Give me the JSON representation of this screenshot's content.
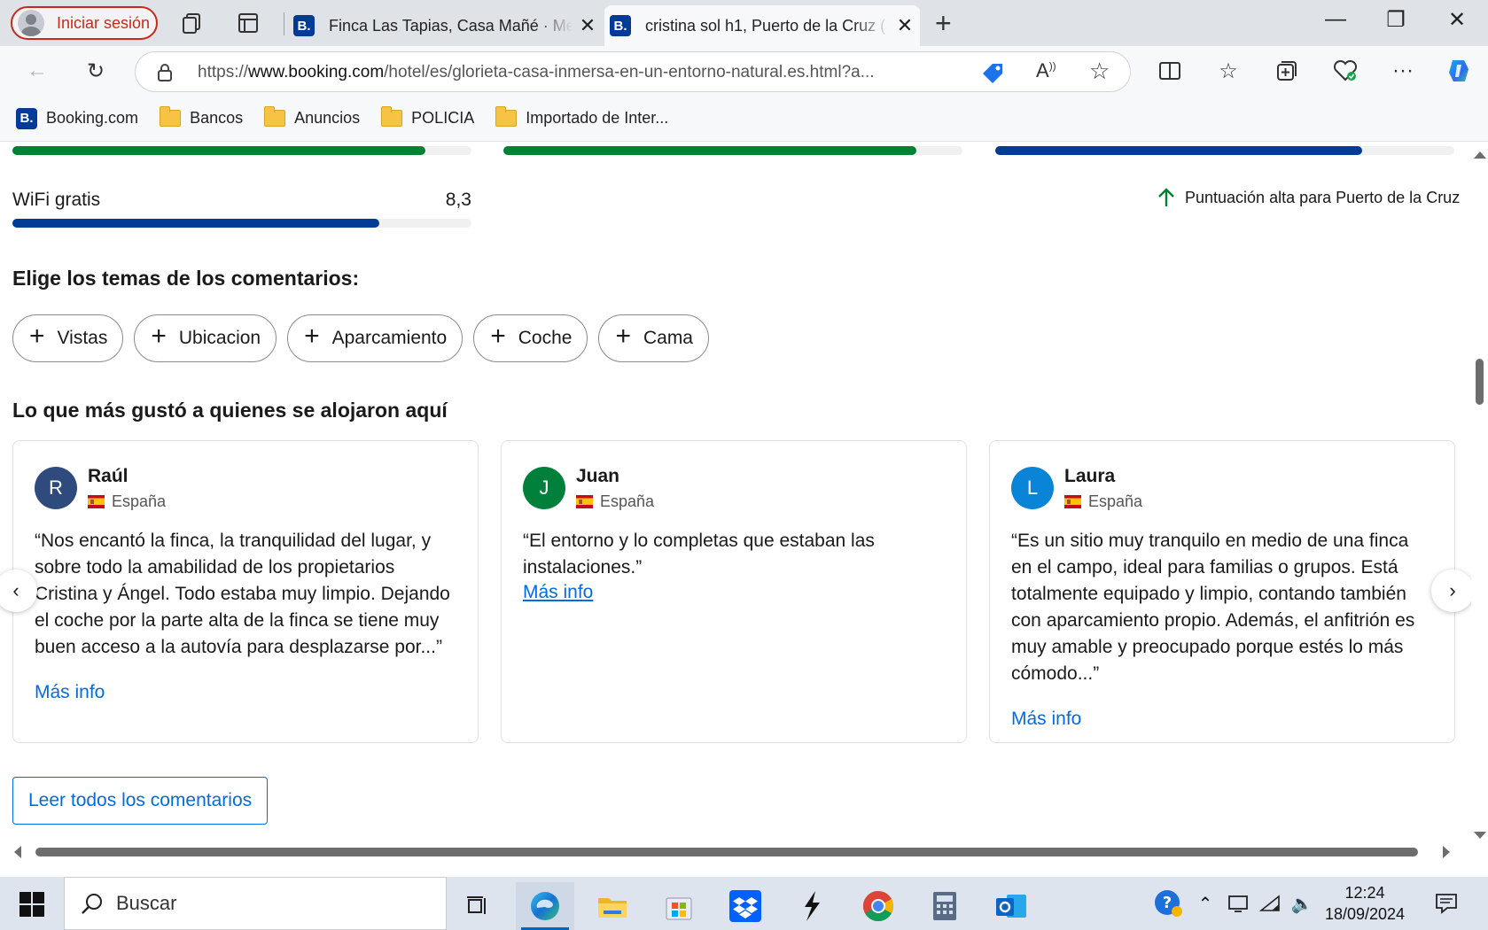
{
  "browser": {
    "profile_label": "Iniciar sesión",
    "tabs": [
      {
        "title": "Finca Las Tapias, Casa Mañé · Mes",
        "favicon": "B.",
        "active": false
      },
      {
        "title": "cristina sol h1, Puerto de la Cruz (",
        "favicon": "B.",
        "active": true
      }
    ],
    "url_prefix": "https://",
    "url_host": "www.booking.com",
    "url_path": "/hotel/es/glorieta-casa-inmersa-en-un-entorno-natural.es.html?a...",
    "bookmarks": [
      {
        "label": "Booking.com",
        "type": "site",
        "icon": "B."
      },
      {
        "label": "Bancos",
        "type": "folder"
      },
      {
        "label": "Anuncios",
        "type": "folder"
      },
      {
        "label": "POLICIA",
        "type": "folder"
      },
      {
        "label": "Importado de Inter...",
        "type": "folder"
      }
    ]
  },
  "scores": {
    "top_bars": [
      {
        "fill_fraction": 0.9,
        "color": "#008234"
      },
      {
        "fill_fraction": 0.9,
        "color": "#008234"
      },
      {
        "fill_fraction": 0.8,
        "color": "#003b95"
      }
    ],
    "wifi": {
      "label": "WiFi gratis",
      "score": "8,3",
      "fill_fraction": 0.8,
      "color": "#003b95"
    },
    "high_note": "Puntuación alta para Puerto de la Cruz"
  },
  "topics": {
    "heading": "Elige los temas de los comentarios:",
    "chips": [
      "Vistas",
      "Ubicacion",
      "Aparcamiento",
      "Coche",
      "Cama"
    ]
  },
  "reviews": {
    "heading": "Lo que más gustó a quienes se alojaron aquí",
    "items": [
      {
        "initial": "R",
        "name": "Raúl",
        "country": "España",
        "avatar_color": "#2f4a7d",
        "text": "“Nos encantó la finca, la tranquilidad del lugar, y sobre todo la amabilidad de los propietarios Cristina y Ángel. Todo estaba muy limpio. Dejando el coche por la parte alta de la finca se tiene muy buen acceso a la autovía para desplazarse por...”",
        "more": "Más info"
      },
      {
        "initial": "J",
        "name": "Juan",
        "country": "España",
        "avatar_color": "#00803a",
        "text": "“El entorno y lo completas que estaban las instalaciones.”",
        "more": "Más info"
      },
      {
        "initial": "L",
        "name": "Laura",
        "country": "España",
        "avatar_color": "#0a84d6",
        "text": "“Es un sitio muy tranquilo en medio de una finca en el campo, ideal para familias o grupos. Está totalmente equipado y limpio, contando también con aparcamiento propio. Además, el anfitrión es muy amable y preocupado porque estés lo más cómodo...”",
        "more": "Más info"
      }
    ],
    "read_all": "Leer todos los comentarios"
  },
  "taskbar": {
    "search_placeholder": "Buscar",
    "time": "12:24",
    "date": "18/09/2024",
    "apps": [
      "task-view",
      "edge",
      "file-explorer",
      "microsoft-store",
      "dropbox",
      "winamp",
      "chrome",
      "calculator",
      "outlook"
    ]
  }
}
